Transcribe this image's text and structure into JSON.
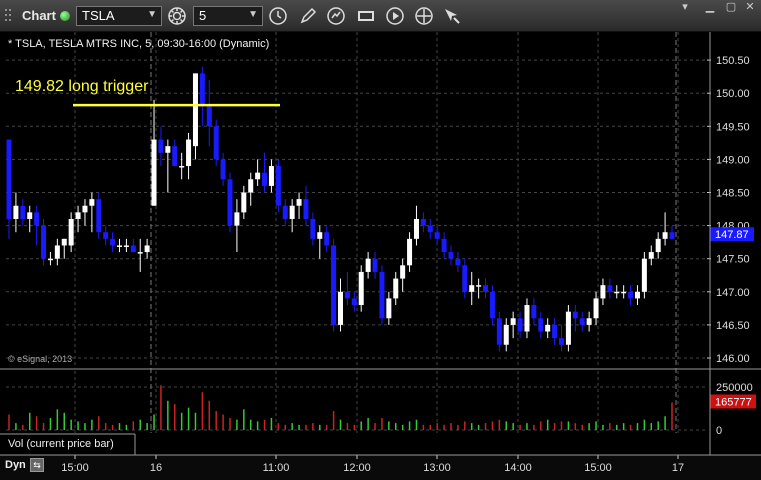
{
  "toolbar": {
    "title": "Chart",
    "symbol": "TSLA",
    "interval": "5"
  },
  "subtitle": "* TSLA, TESLA MTRS INC, 5, 09:30-16:00 (Dynamic)",
  "watermark": "© eSignal, 2013",
  "annotation": {
    "text": "149.82 long trigger",
    "value": 149.82,
    "color": "#ffff33"
  },
  "volume_label": "Vol (current price bar)",
  "bottom_left_label": "Dyn",
  "colors": {
    "up": "#ffffff",
    "down": "#1a1aff",
    "vol_up": "#33cc33",
    "vol_down": "#cc2222",
    "grid": "#444444"
  },
  "chart_data": [
    {
      "type": "candlestick",
      "title": "TSLA",
      "ylim": [
        145.9,
        150.7
      ],
      "y_ticks": [
        "150.50",
        "150.00",
        "149.50",
        "149.00",
        "148.50",
        "148.00",
        "147.50",
        "147.00",
        "146.50",
        "146.00"
      ],
      "x_ticks": [
        "15:00",
        "16",
        "11:00",
        "12:00",
        "13:00",
        "14:00",
        "15:00",
        "17"
      ],
      "last_price": "147.87",
      "day_separators": [
        "16",
        "17"
      ],
      "ohlc": [
        [
          149.3,
          149.3,
          147.8,
          148.1
        ],
        [
          148.1,
          148.5,
          147.9,
          148.3
        ],
        [
          148.3,
          148.4,
          148.0,
          148.1
        ],
        [
          148.1,
          148.3,
          147.9,
          148.2
        ],
        [
          148.2,
          148.3,
          147.7,
          148.0
        ],
        [
          148.0,
          148.1,
          147.4,
          147.5
        ],
        [
          147.5,
          147.6,
          147.4,
          147.5
        ],
        [
          147.5,
          147.8,
          147.4,
          147.7
        ],
        [
          147.7,
          147.8,
          147.5,
          147.8
        ],
        [
          147.7,
          148.2,
          147.6,
          148.1
        ],
        [
          148.1,
          148.3,
          147.9,
          148.2
        ],
        [
          148.2,
          148.4,
          148.0,
          148.3
        ],
        [
          148.3,
          148.5,
          147.9,
          148.4
        ],
        [
          148.4,
          148.5,
          147.8,
          147.9
        ],
        [
          147.9,
          148.0,
          147.7,
          147.8
        ],
        [
          147.8,
          147.9,
          147.6,
          147.7
        ],
        [
          147.7,
          147.8,
          147.6,
          147.7
        ],
        [
          147.7,
          147.8,
          147.6,
          147.7
        ],
        [
          147.7,
          147.8,
          147.6,
          147.6
        ],
        [
          147.6,
          147.8,
          147.3,
          147.6
        ],
        [
          147.6,
          147.8,
          147.5,
          147.7
        ],
        [
          148.3,
          149.9,
          148.3,
          149.3
        ],
        [
          149.3,
          149.5,
          148.9,
          149.1
        ],
        [
          149.1,
          149.3,
          148.5,
          149.2
        ],
        [
          149.2,
          149.3,
          148.9,
          148.9
        ],
        [
          148.9,
          149.1,
          148.7,
          148.9
        ],
        [
          148.9,
          149.4,
          148.7,
          149.3
        ],
        [
          149.2,
          150.2,
          149.0,
          150.3
        ],
        [
          150.3,
          150.4,
          149.5,
          149.8
        ],
        [
          149.8,
          150.2,
          149.2,
          149.5
        ],
        [
          149.5,
          149.6,
          148.9,
          149.0
        ],
        [
          149.0,
          149.1,
          148.6,
          148.7
        ],
        [
          148.7,
          148.8,
          147.9,
          148.0
        ],
        [
          148.0,
          148.4,
          147.6,
          148.2
        ],
        [
          148.2,
          148.6,
          148.1,
          148.5
        ],
        [
          148.5,
          148.8,
          148.3,
          148.7
        ],
        [
          148.7,
          149.0,
          148.6,
          148.8
        ],
        [
          148.8,
          149.1,
          148.5,
          148.6
        ],
        [
          148.6,
          149.0,
          148.5,
          148.9
        ],
        [
          148.9,
          149.0,
          148.2,
          148.3
        ],
        [
          148.3,
          148.4,
          148.0,
          148.1
        ],
        [
          148.1,
          148.4,
          147.9,
          148.3
        ],
        [
          148.3,
          148.5,
          148.1,
          148.4
        ],
        [
          148.4,
          148.6,
          148.0,
          148.1
        ],
        [
          148.1,
          148.2,
          147.7,
          147.8
        ],
        [
          147.8,
          148.0,
          147.5,
          147.9
        ],
        [
          147.9,
          148.0,
          147.6,
          147.7
        ],
        [
          147.7,
          147.8,
          146.4,
          146.5
        ],
        [
          146.5,
          147.2,
          146.4,
          147.0
        ],
        [
          147.0,
          147.3,
          146.8,
          146.9
        ],
        [
          146.9,
          147.0,
          146.7,
          146.8
        ],
        [
          146.8,
          147.4,
          146.7,
          147.3
        ],
        [
          147.3,
          147.6,
          147.2,
          147.5
        ],
        [
          147.5,
          147.6,
          147.2,
          147.3
        ],
        [
          147.3,
          147.4,
          146.5,
          146.6
        ],
        [
          146.6,
          147.0,
          146.5,
          146.9
        ],
        [
          146.9,
          147.3,
          146.8,
          147.2
        ],
        [
          147.2,
          147.5,
          147.0,
          147.4
        ],
        [
          147.4,
          147.9,
          147.3,
          147.8
        ],
        [
          147.8,
          148.3,
          147.7,
          148.1
        ],
        [
          148.1,
          148.2,
          147.9,
          148.0
        ],
        [
          148.0,
          148.1,
          147.8,
          147.9
        ],
        [
          147.9,
          148.0,
          147.7,
          147.8
        ],
        [
          147.8,
          147.9,
          147.5,
          147.6
        ],
        [
          147.6,
          147.7,
          147.4,
          147.5
        ],
        [
          147.5,
          147.6,
          147.3,
          147.4
        ],
        [
          147.4,
          147.5,
          146.9,
          147.0
        ],
        [
          147.0,
          147.3,
          146.8,
          147.1
        ],
        [
          147.1,
          147.2,
          146.9,
          147.1
        ],
        [
          147.1,
          147.2,
          146.9,
          147.0
        ],
        [
          147.0,
          147.1,
          146.5,
          146.6
        ],
        [
          146.6,
          146.7,
          146.1,
          146.2
        ],
        [
          146.2,
          146.6,
          146.1,
          146.5
        ],
        [
          146.5,
          146.7,
          146.3,
          146.6
        ],
        [
          146.6,
          146.7,
          146.3,
          146.4
        ],
        [
          146.4,
          146.9,
          146.3,
          146.8
        ],
        [
          146.8,
          146.9,
          146.5,
          146.6
        ],
        [
          146.6,
          146.7,
          146.3,
          146.4
        ],
        [
          146.4,
          146.6,
          146.3,
          146.5
        ],
        [
          146.5,
          146.6,
          146.2,
          146.3
        ],
        [
          146.3,
          146.5,
          146.1,
          146.2
        ],
        [
          146.2,
          146.8,
          146.1,
          146.7
        ],
        [
          146.7,
          146.8,
          146.4,
          146.6
        ],
        [
          146.6,
          146.7,
          146.4,
          146.5
        ],
        [
          146.5,
          146.7,
          146.4,
          146.6
        ],
        [
          146.6,
          147.0,
          146.5,
          146.9
        ],
        [
          146.9,
          147.2,
          146.8,
          147.1
        ],
        [
          147.1,
          147.2,
          146.9,
          147.0
        ],
        [
          147.0,
          147.1,
          146.9,
          147.0
        ],
        [
          147.0,
          147.1,
          146.9,
          147.0
        ],
        [
          147.0,
          147.1,
          146.8,
          146.9
        ],
        [
          146.9,
          147.1,
          146.8,
          147.0
        ],
        [
          147.0,
          147.6,
          146.9,
          147.5
        ],
        [
          147.5,
          147.7,
          147.4,
          147.6
        ],
        [
          147.6,
          147.9,
          147.5,
          147.8
        ],
        [
          147.8,
          148.2,
          147.7,
          147.9
        ],
        [
          147.9,
          148.0,
          147.8,
          147.8
        ]
      ]
    },
    {
      "type": "bar",
      "title": "Vol (current price bar)",
      "ylim": [
        0,
        250000
      ],
      "y_ticks": [
        "250000",
        "0"
      ],
      "last_value": "165777",
      "values": [
        90000,
        40000,
        30000,
        100000,
        80000,
        40000,
        70000,
        120000,
        100000,
        60000,
        50000,
        40000,
        60000,
        80000,
        40000,
        30000,
        40000,
        30000,
        50000,
        60000,
        40000,
        90000,
        260000,
        170000,
        150000,
        100000,
        130000,
        100000,
        220000,
        170000,
        110000,
        90000,
        70000,
        60000,
        120000,
        60000,
        50000,
        60000,
        70000,
        40000,
        30000,
        40000,
        30000,
        30000,
        40000,
        30000,
        30000,
        110000,
        60000,
        40000,
        30000,
        50000,
        70000,
        40000,
        70000,
        50000,
        40000,
        30000,
        50000,
        60000,
        30000,
        30000,
        40000,
        30000,
        40000,
        30000,
        50000,
        40000,
        30000,
        40000,
        50000,
        60000,
        50000,
        40000,
        30000,
        40000,
        30000,
        50000,
        60000,
        40000,
        50000,
        50000,
        40000,
        30000,
        40000,
        50000,
        30000,
        40000,
        30000,
        40000,
        30000,
        40000,
        60000,
        40000,
        50000,
        80000,
        160000
      ]
    }
  ]
}
